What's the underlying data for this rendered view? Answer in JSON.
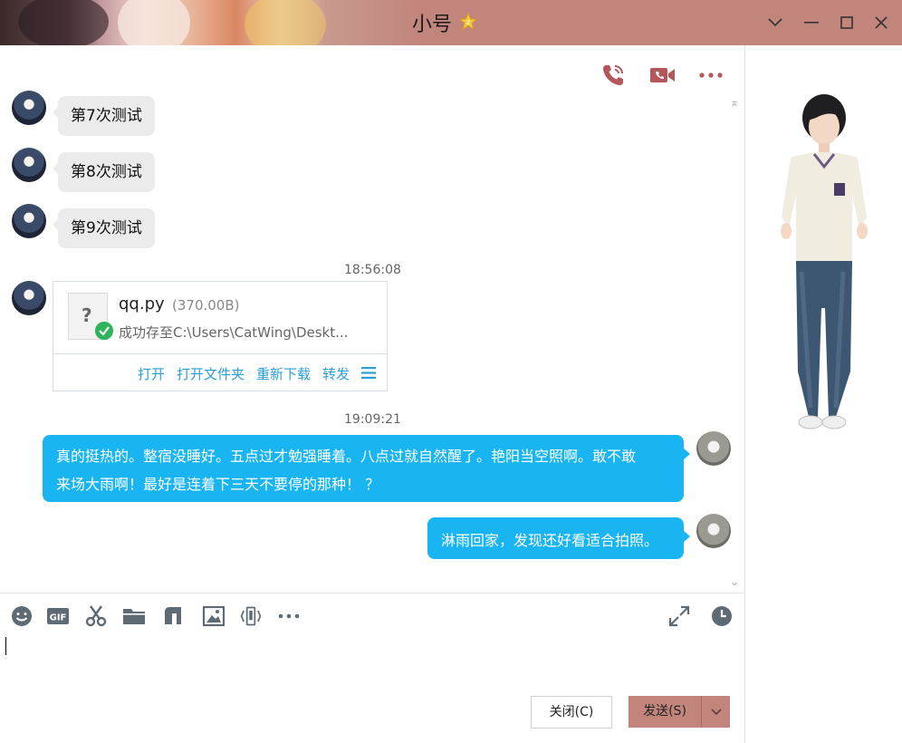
{
  "window": {
    "title": "小号"
  },
  "messages": [
    {
      "text": "第7次测试"
    },
    {
      "text": "第8次测试"
    },
    {
      "text": "第9次测试"
    }
  ],
  "timestamps": [
    "18:56:08",
    "19:09:21"
  ],
  "file": {
    "name": "qq.py",
    "size": "(370.00B)",
    "status": "成功存至C:\\Users\\CatWing\\Deskt...",
    "actions": [
      "打开",
      "打开文件夹",
      "重新下载",
      "转发"
    ]
  },
  "outgoing": [
    {
      "lines": [
        "真的挺热的。整宿没睡好。五点过才勉强睡着。八点过就自然醒了。艳阳当空照啊。敢不敢",
        "来场大雨啊！最好是连着下三天不要停的那种！ ？"
      ]
    },
    {
      "lines": [
        "淋雨回家，发现还好看适合拍照。"
      ]
    }
  ],
  "buttons": {
    "close": "关闭(C)",
    "send": "发送(S)"
  },
  "colors": {
    "accent": "#c1857c",
    "bubble_out": "#19b4f2",
    "link": "#2a9fd6"
  }
}
